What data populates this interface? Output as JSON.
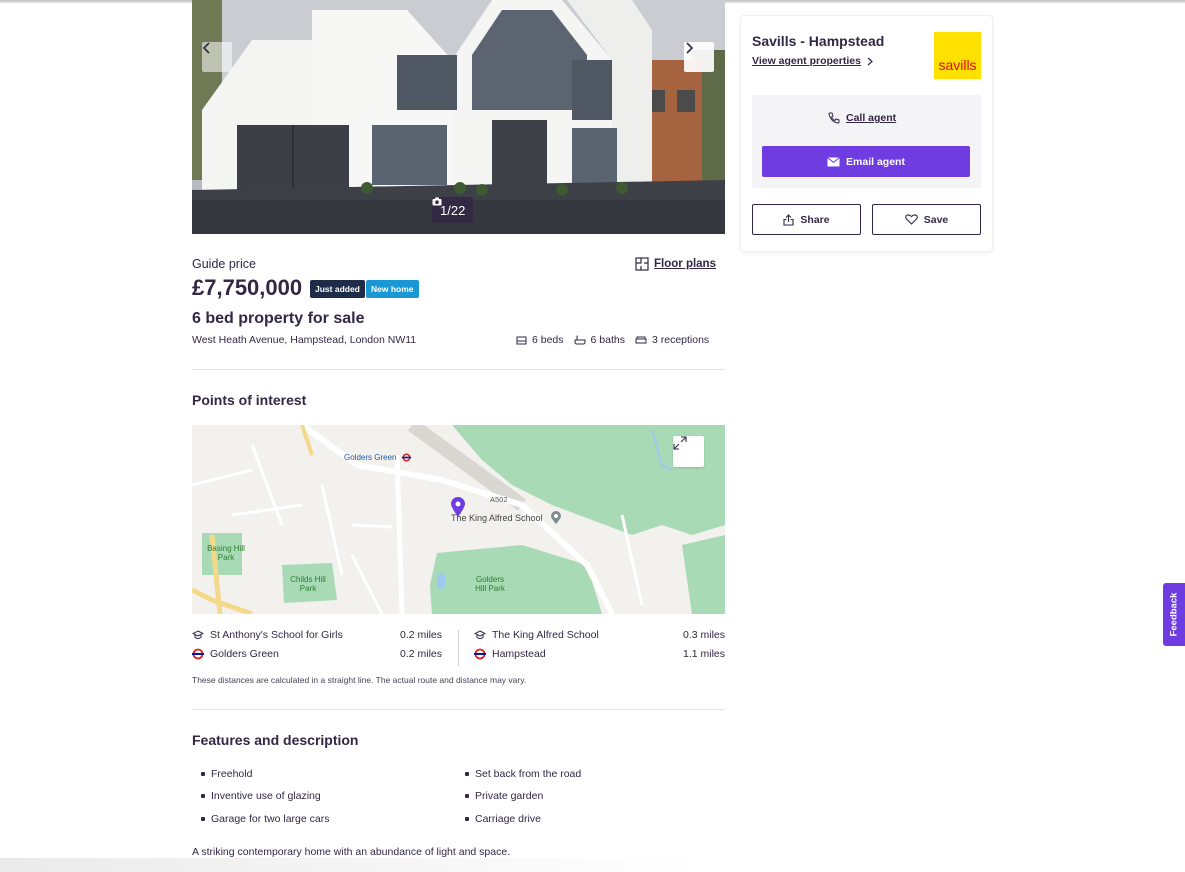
{
  "gallery": {
    "photo_counter": "1/22"
  },
  "listing": {
    "price_label": "Guide price",
    "price": "£7,750,000",
    "badges": [
      "Just added",
      "New home"
    ],
    "floorplans_label": "Floor plans",
    "headline": "6 bed property for sale",
    "address": "West Heath Avenue, Hampstead, London NW11",
    "beds": "6 beds",
    "baths": "6 baths",
    "receptions": "3 receptions"
  },
  "poi": {
    "title": "Points of interest",
    "map_labels": {
      "golders_green": "Golders Green",
      "king_alfred": "The King Alfred School",
      "basing_hill_park": "Basing Hill Park",
      "childs_hill_park": "Childs Hill Park",
      "golders_hill_park": "Golders Hill Park",
      "a502": "A502"
    },
    "items": [
      {
        "name": "St Anthony's School for Girls",
        "distance": "0.2 miles",
        "type": "school"
      },
      {
        "name": "Golders Green",
        "distance": "0.2 miles",
        "type": "station"
      },
      {
        "name": "The King Alfred School",
        "distance": "0.3 miles",
        "type": "school"
      },
      {
        "name": "Hampstead",
        "distance": "1.1 miles",
        "type": "station"
      }
    ],
    "disclaimer": "These distances are calculated in a straight line. The actual route and distance may vary."
  },
  "features": {
    "title": "Features and description",
    "left": [
      "Freehold",
      "Inventive use of glazing",
      "Garage for two large cars"
    ],
    "right": [
      "Set back from the road",
      "Private garden",
      "Carriage drive"
    ],
    "description": "A striking contemporary home with an abundance of light and space."
  },
  "agent": {
    "name": "Savills - Hampstead",
    "view_link": "View agent properties",
    "logo_text": "savills",
    "call_label": "Call agent",
    "email_label": "Email agent",
    "share_label": "Share",
    "save_label": "Save"
  },
  "feedback_label": "Feedback",
  "colors": {
    "brand_purple": "#6e3ce0",
    "text": "#322744",
    "badge_dark": "#1e2c4a",
    "badge_blue": "#1a97d5",
    "logo_yellow": "#ffe100",
    "logo_red": "#e30613"
  }
}
